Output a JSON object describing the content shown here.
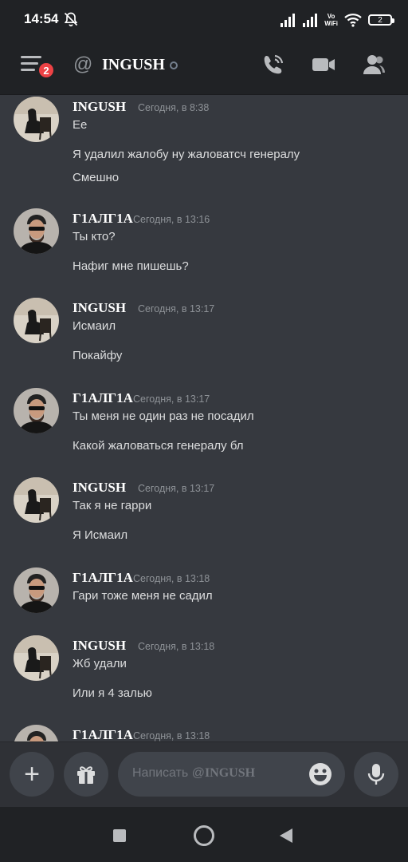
{
  "status_bar": {
    "time": "14:54",
    "vowifi": "Vo\nWiFi",
    "battery": "2"
  },
  "header": {
    "badge_count": "2",
    "channel_title": "INGUSH"
  },
  "messages": [
    {
      "author": "INGUSH",
      "time": "Сегодня, в 8:38",
      "lines": [
        "Ее",
        "Я удалил жалобу ну жаловатсч генералу",
        "Смешно"
      ],
      "avatar": "ingush"
    },
    {
      "author": "Г1АЛГ1А",
      "time": "Сегодня, в 13:16",
      "lines": [
        "Ты кто?",
        "Нафиг мне пишешь?"
      ],
      "avatar": "galgia"
    },
    {
      "author": "INGUSH",
      "time": "Сегодня, в 13:17",
      "lines": [
        "Исмаил",
        "Покайфу"
      ],
      "avatar": "ingush"
    },
    {
      "author": "Г1АЛГ1А",
      "time": "Сегодня, в 13:17",
      "lines": [
        "Ты меня не один раз не посадил",
        "Какой жаловаться генералу бл"
      ],
      "avatar": "galgia"
    },
    {
      "author": "INGUSH",
      "time": "Сегодня, в 13:17",
      "lines": [
        "Так я не гарри",
        "Я Исмаил"
      ],
      "avatar": "ingush"
    },
    {
      "author": "Г1АЛГ1А",
      "time": "Сегодня, в 13:18",
      "lines": [
        "Гари тоже меня не садил"
      ],
      "avatar": "galgia"
    },
    {
      "author": "INGUSH",
      "time": "Сегодня, в 13:18",
      "lines": [
        "Жб удали",
        "Или я 4 залью"
      ],
      "avatar": "ingush"
    },
    {
      "author": "Г1АЛГ1А",
      "time": "Сегодня, в 13:18",
      "lines": [],
      "avatar": "galgia"
    }
  ],
  "composer": {
    "placeholder_prefix": "Написать @",
    "placeholder_name": "INGUSH"
  },
  "colors": {
    "background": "#36393f",
    "header": "#202225",
    "badge": "#ed4245",
    "input": "#40444b"
  },
  "icons": [
    "bell-off-icon",
    "signal-icon",
    "wifi-icon",
    "menu-icon",
    "at-icon",
    "phone-call-icon",
    "video-call-icon",
    "members-icon",
    "plus-icon",
    "gift-icon",
    "emoji-icon",
    "microphone-icon",
    "nav-recents-icon",
    "nav-home-icon",
    "nav-back-icon"
  ]
}
